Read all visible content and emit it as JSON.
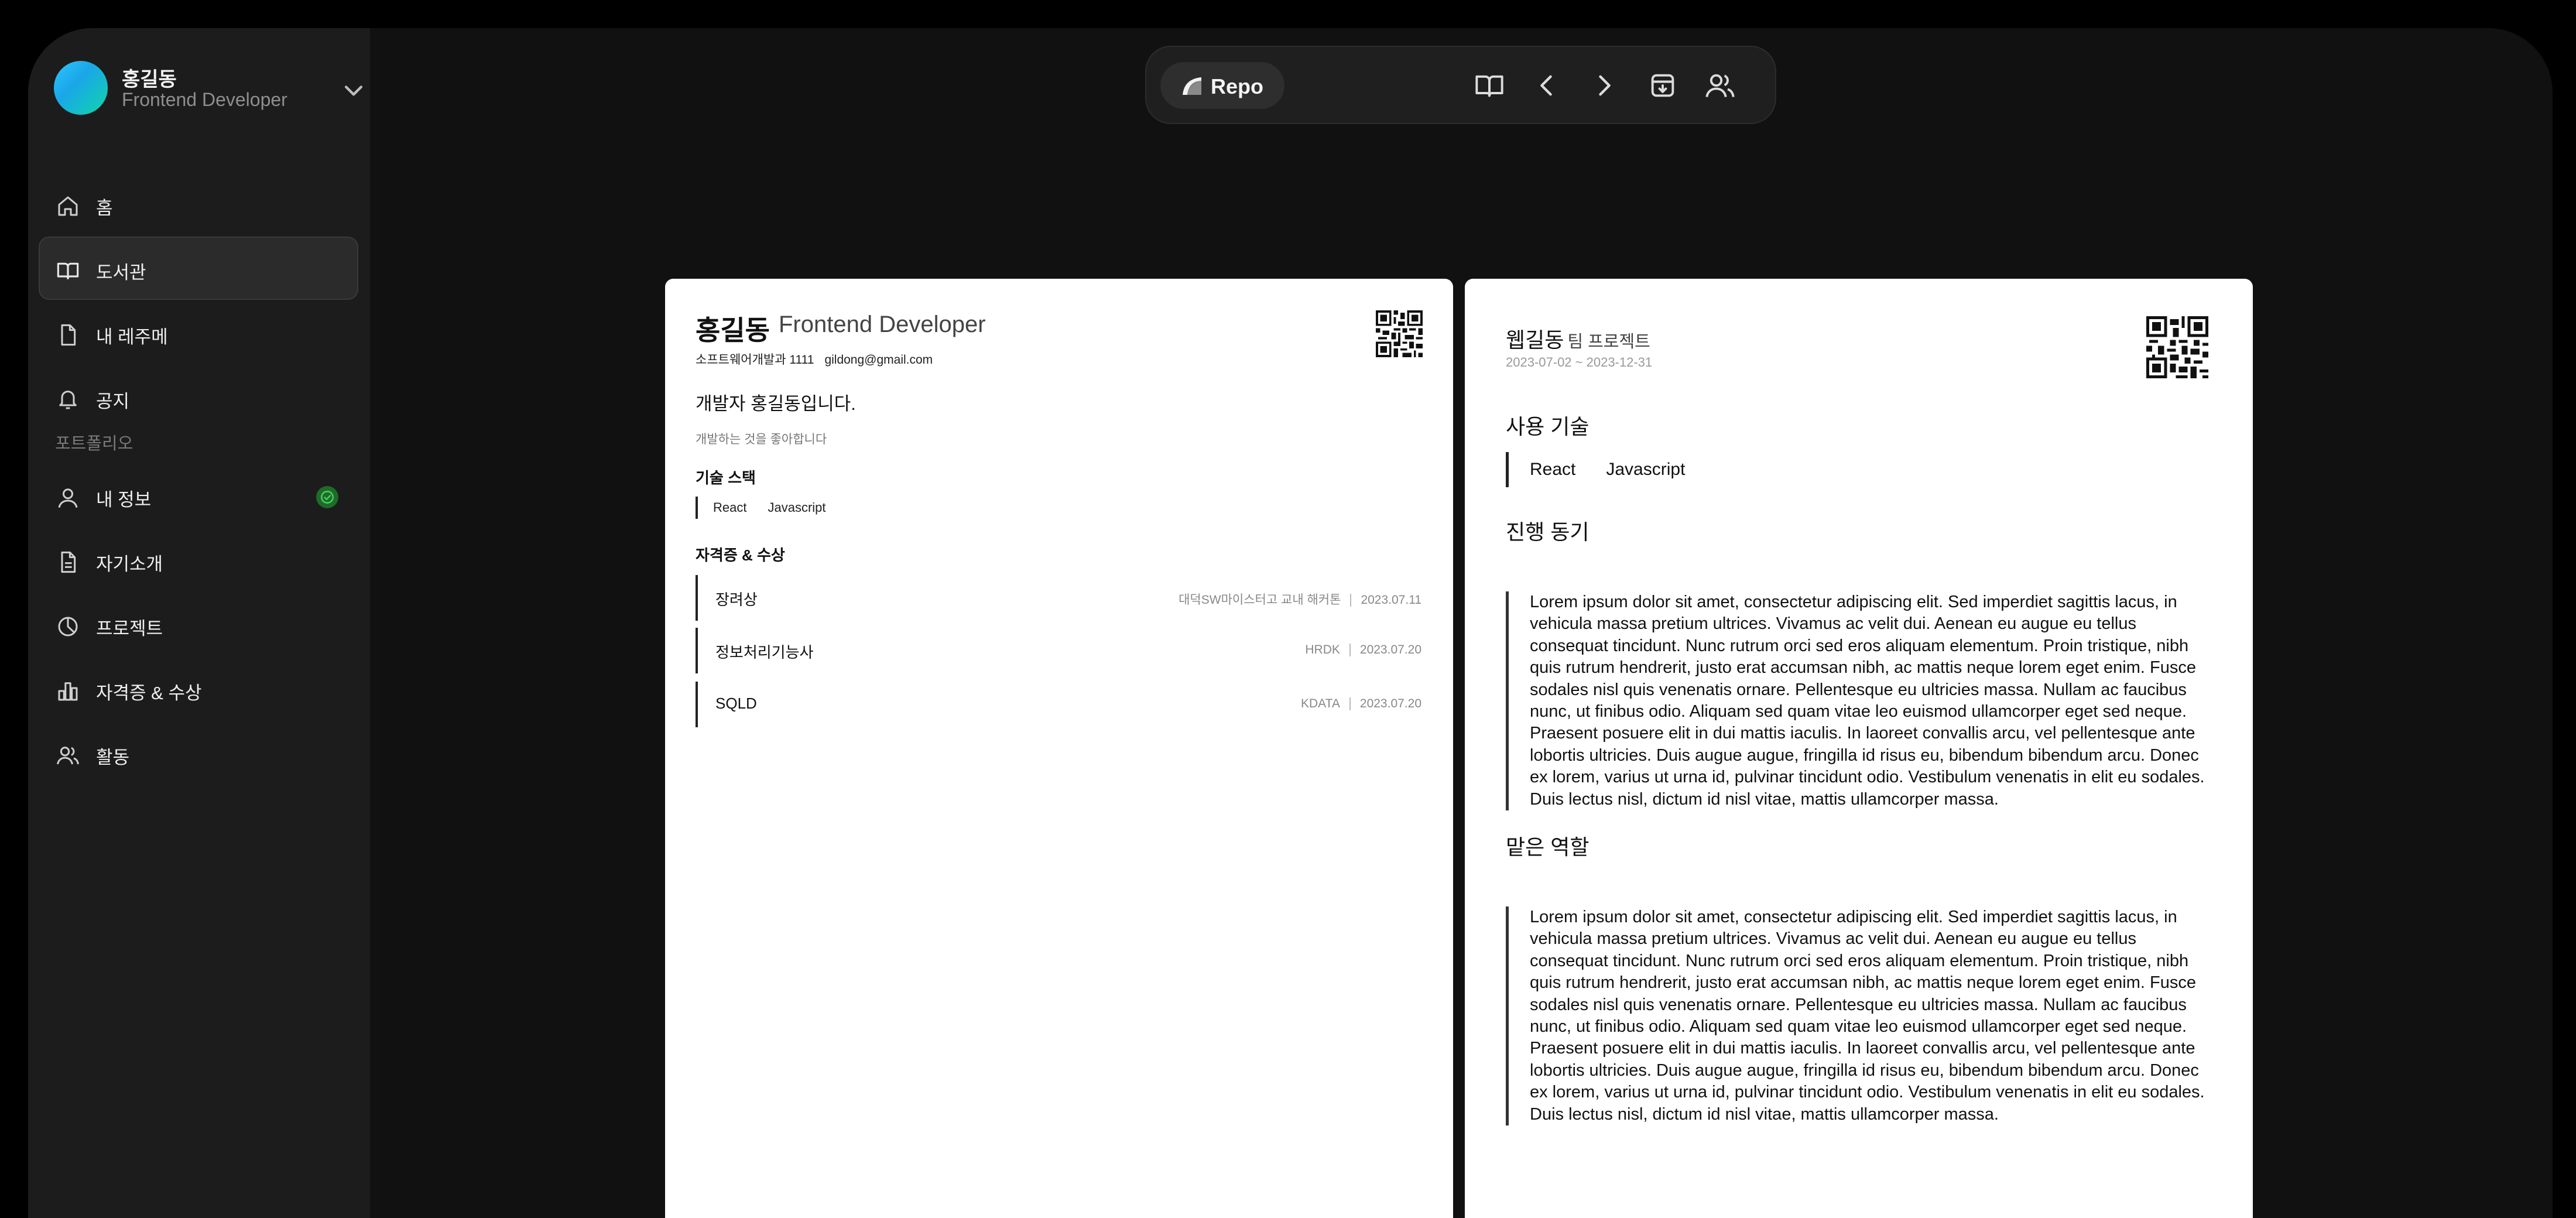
{
  "sidebar": {
    "profile": {
      "name": "홍길동",
      "role": "Frontend Developer"
    },
    "items": [
      {
        "label": "홈",
        "icon": "home-icon"
      },
      {
        "label": "도서관",
        "icon": "book-icon",
        "active": true
      },
      {
        "label": "내 레주메",
        "icon": "document-icon"
      },
      {
        "label": "공지",
        "icon": "bell-icon"
      }
    ],
    "section_label": "포트폴리오",
    "portfolio_items": [
      {
        "label": "내 정보",
        "icon": "user-icon",
        "badge": "check-circle-icon"
      },
      {
        "label": "자기소개",
        "icon": "file-text-icon"
      },
      {
        "label": "프로젝트",
        "icon": "pie-chart-icon"
      },
      {
        "label": "자격증 & 수상",
        "icon": "bar-chart-icon"
      },
      {
        "label": "활동",
        "icon": "users-icon"
      }
    ]
  },
  "toolbar": {
    "repo_label": "Repo",
    "buttons": [
      "book-open-icon",
      "chevron-left-icon",
      "chevron-right-icon",
      "archive-download-icon",
      "users-icon"
    ]
  },
  "resume": {
    "name": "홍길동",
    "role": "Frontend Developer",
    "department": "소프트웨어개발과 1111",
    "email": "gildong@gmail.com",
    "headline": "개발자 홍길동입니다.",
    "intro": "개발하는 것을 좋아합니다",
    "skills_title": "기술 스택",
    "skills": [
      "React",
      "Javascript"
    ],
    "awards_title": "자격증 & 수상",
    "awards": [
      {
        "name": "장려상",
        "issuer": "대덕SW마이스터고 교내 해커톤",
        "date": "2023.07.11"
      },
      {
        "name": "정보처리기능사",
        "issuer": "HRDK",
        "date": "2023.07.20"
      },
      {
        "name": "SQLD",
        "issuer": "KDATA",
        "date": "2023.07.20"
      }
    ]
  },
  "project": {
    "title": "웹길동",
    "type": "팀 프로젝트",
    "period": "2023-07-02 ~ 2023-12-31",
    "skills_title": "사용 기술",
    "skills": [
      "React",
      "Javascript"
    ],
    "motivation_title": "진행 동기",
    "motivation": "Lorem ipsum dolor sit amet, consectetur adipiscing elit. Sed imperdiet sagittis lacus, in vehicula massa pretium ultrices. Vivamus ac velit dui. Aenean eu augue eu tellus consequat tincidunt. Nunc rutrum orci sed eros aliquam elementum. Proin tristique, nibh quis rutrum hendrerit, justo erat accumsan nibh, ac mattis neque lorem eget enim. Fusce sodales nisl quis venenatis ornare. Pellentesque eu ultricies massa. Nullam ac faucibus nunc, ut finibus odio. Aliquam sed quam vitae leo euismod ullamcorper eget sed neque. Praesent posuere elit in dui mattis iaculis. In laoreet convallis arcu, vel pellentesque ante lobortis ultricies. Duis augue augue, fringilla id risus eu, bibendum bibendum arcu. Donec ex lorem, varius ut urna id, pulvinar tincidunt odio. Vestibulum venenatis in elit eu sodales. Duis lectus nisl, dictum id nisl vitae, mattis ullamcorper massa.",
    "role_title": "맡은 역할",
    "role": "Lorem ipsum dolor sit amet, consectetur adipiscing elit. Sed imperdiet sagittis lacus, in vehicula massa pretium ultrices. Vivamus ac velit dui. Aenean eu augue eu tellus consequat tincidunt. Nunc rutrum orci sed eros aliquam elementum. Proin tristique, nibh quis rutrum hendrerit, justo erat accumsan nibh, ac mattis neque lorem eget enim. Fusce sodales nisl quis venenatis ornare. Pellentesque eu ultricies massa. Nullam ac faucibus nunc, ut finibus odio. Aliquam sed quam vitae leo euismod ullamcorper eget sed neque. Praesent posuere elit in dui mattis iaculis. In laoreet convallis arcu, vel pellentesque ante lobortis ultricies. Duis augue augue, fringilla id risus eu, bibendum bibendum arcu. Donec ex lorem, varius ut urna id, pulvinar tincidunt odio. Vestibulum venenatis in elit eu sodales. Duis lectus nisl, dictum id nisl vitae, mattis ullamcorper massa."
  },
  "colors": {
    "avatar_start": "#2ec7ff",
    "avatar_end": "#0fd7a8",
    "badge": "#1f6b2a",
    "badge_check": "#45d35c"
  }
}
